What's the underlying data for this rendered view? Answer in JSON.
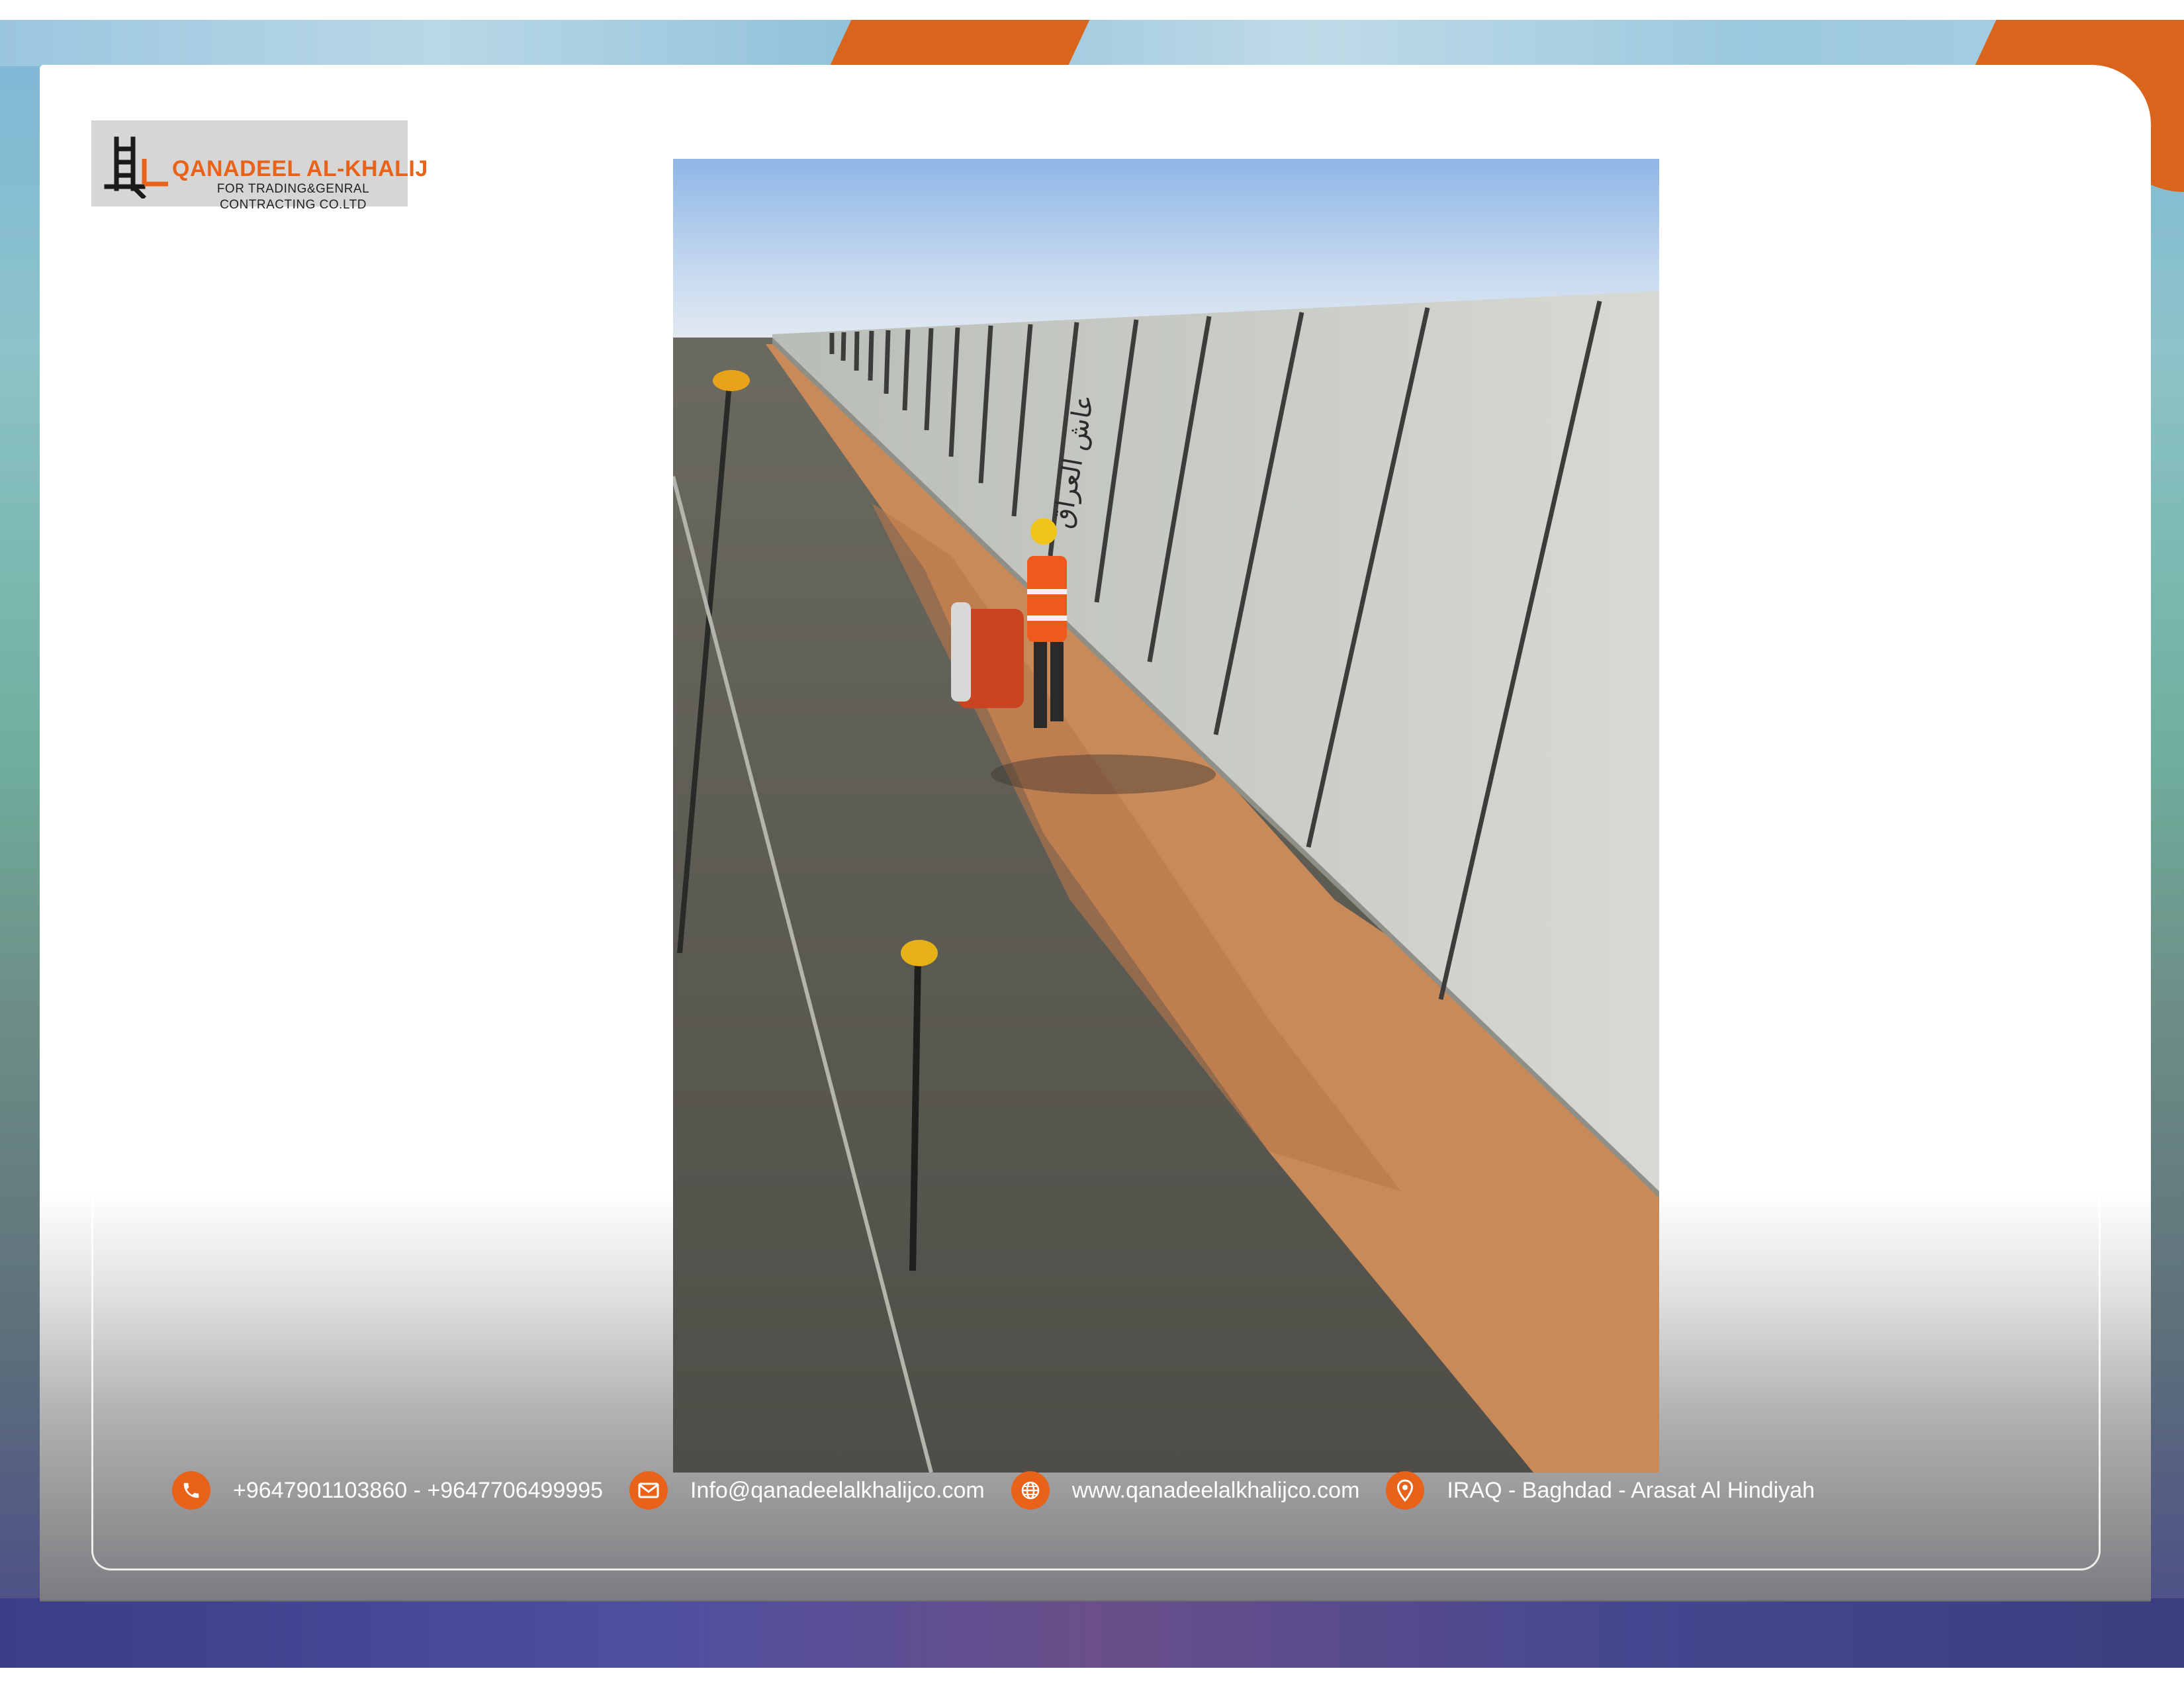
{
  "logo": {
    "title": "QANADEEL AL-KHALIJ",
    "subtitle_line1": "FOR TRADING&GENRAL",
    "subtitle_line2": "CONTRACTING CO.LTD"
  },
  "photo": {
    "wall_graffiti": "عاش العراق"
  },
  "footer": {
    "phone": "+9647901103860 - +9647706499995",
    "email": "Info@qanadeelalkhalijco.com",
    "website": "www.qanadeelalkhalijco.com",
    "address": "IRAQ - Baghdad - Arasat Al Hindiyah",
    "icons": [
      "phone-icon",
      "mail-icon",
      "globe-icon",
      "location-pin-icon"
    ]
  },
  "colors": {
    "accent": "#e8621a",
    "brand_dark": "#222222"
  }
}
